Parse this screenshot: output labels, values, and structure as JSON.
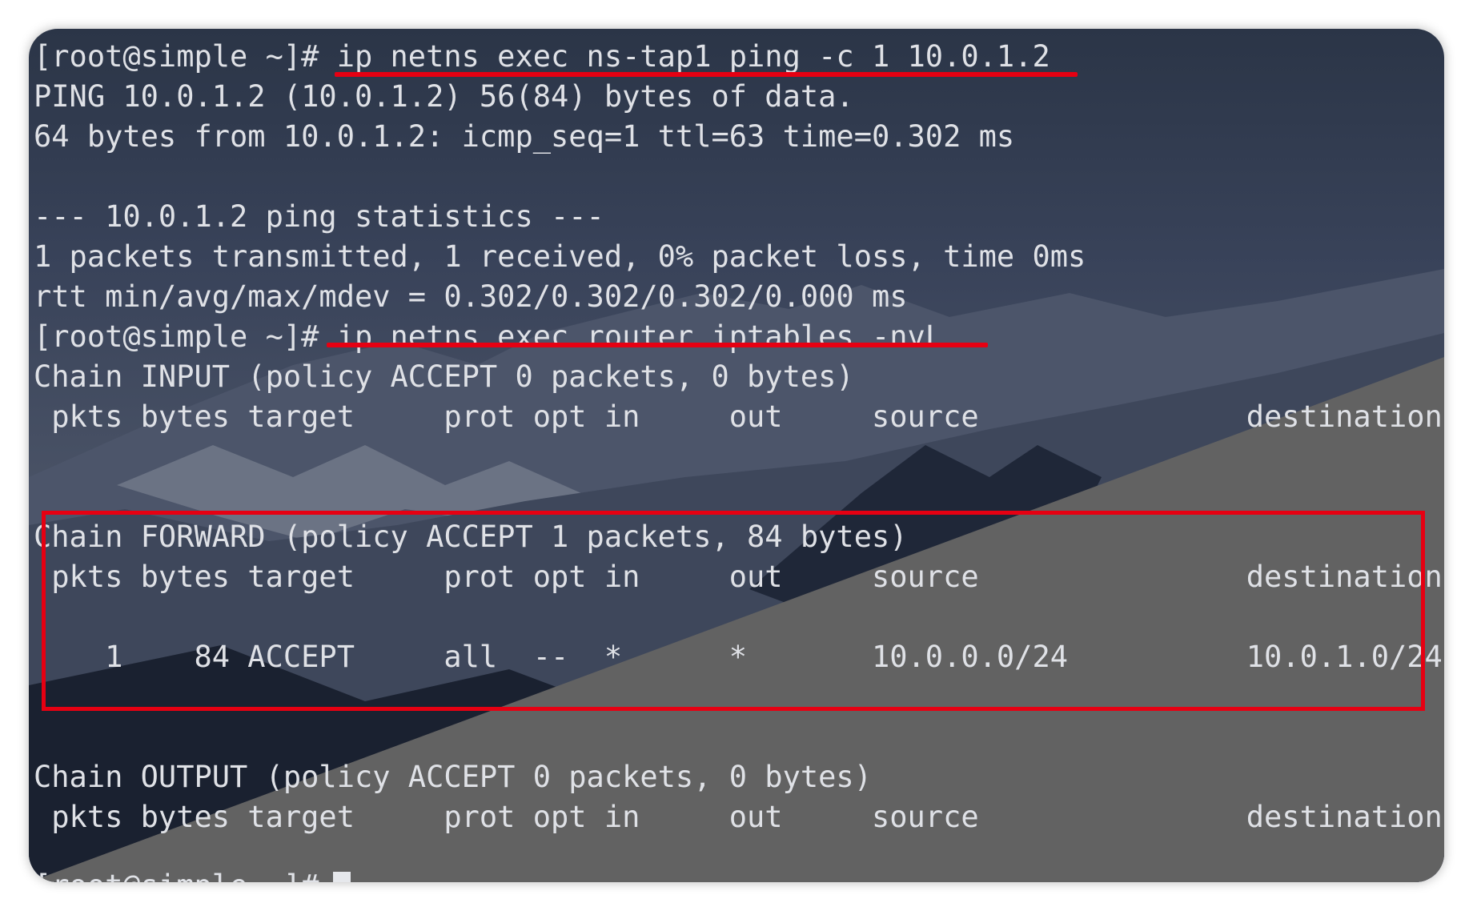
{
  "colors": {
    "annotation_red": "#e60012",
    "terminal_text": "#dfe1e6"
  },
  "terminal": {
    "lines": [
      "[root@simple ~]# ip netns exec ns-tap1 ping -c 1 10.0.1.2",
      "PING 10.0.1.2 (10.0.1.2) 56(84) bytes of data.",
      "64 bytes from 10.0.1.2: icmp_seq=1 ttl=63 time=0.302 ms",
      "",
      "--- 10.0.1.2 ping statistics ---",
      "1 packets transmitted, 1 received, 0% packet loss, time 0ms",
      "rtt min/avg/max/mdev = 0.302/0.302/0.302/0.000 ms",
      "[root@simple ~]# ip netns exec router iptables -nvL",
      "Chain INPUT (policy ACCEPT 0 packets, 0 bytes)",
      " pkts bytes target     prot opt in     out     source               destination",
      "",
      "",
      "Chain FORWARD (policy ACCEPT 1 packets, 84 bytes)",
      " pkts bytes target     prot opt in     out     source               destination",
      "",
      "    1    84 ACCEPT     all  --  *      *       10.0.0.0/24          10.0.1.0/24",
      "",
      "",
      "Chain OUTPUT (policy ACCEPT 0 packets, 0 bytes)",
      " pkts bytes target     prot opt in     out     source               destination",
      "",
      "[root@simple ~]# "
    ]
  }
}
